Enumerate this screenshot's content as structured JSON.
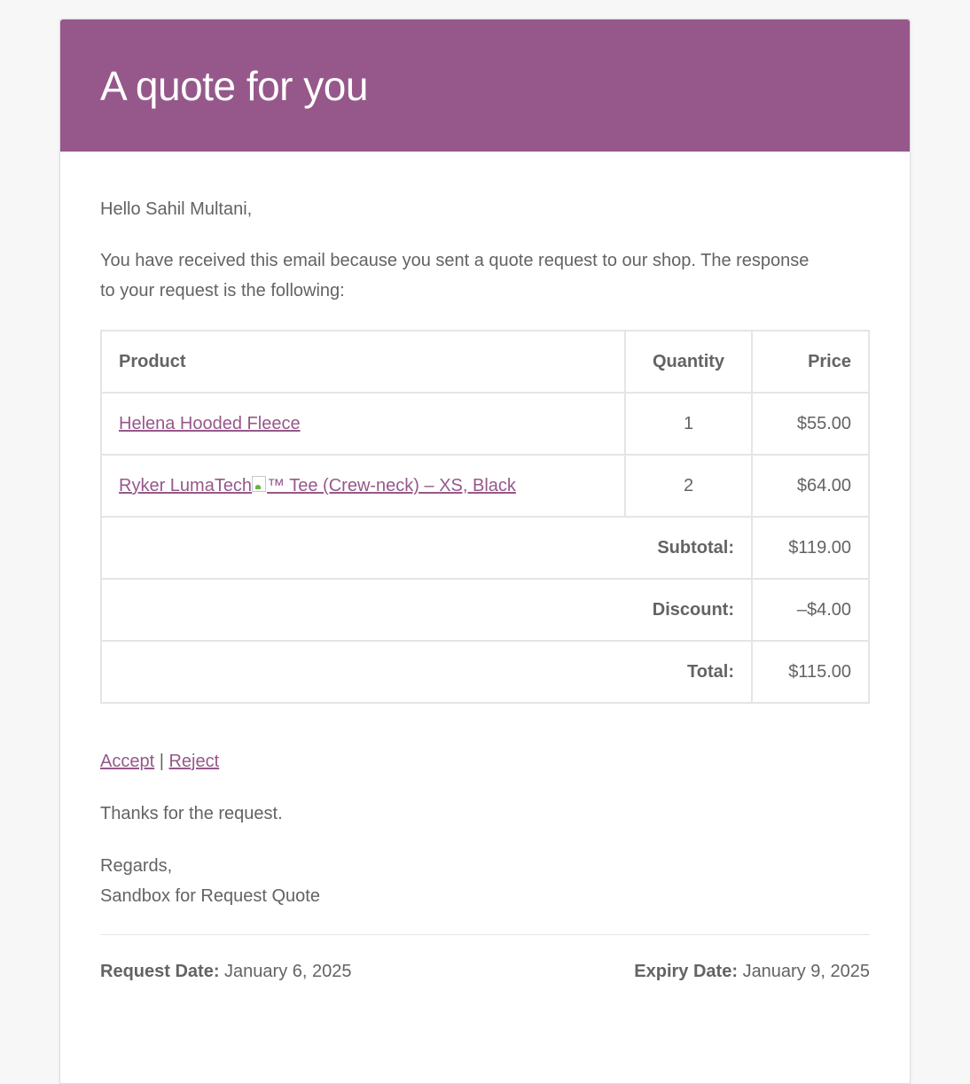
{
  "header": {
    "title": "A quote for you"
  },
  "body": {
    "greeting": "Hello Sahil Multani,",
    "intro": "You have received this email because you sent a quote request to our shop. The response to your request is the following:"
  },
  "table": {
    "headers": {
      "product": "Product",
      "quantity": "Quantity",
      "price": "Price"
    },
    "rows": [
      {
        "product": "Helena Hooded Fleece",
        "quantity": "1",
        "price": "$55.00"
      },
      {
        "product_prefix": "Ryker LumaTech",
        "product_suffix": "™ Tee (Crew-neck) – XS, Black",
        "quantity": "2",
        "price": "$64.00"
      }
    ],
    "totals": [
      {
        "label": "Subtotal:",
        "value": "$119.00"
      },
      {
        "label": "Discount:",
        "value": "–$4.00"
      },
      {
        "label": "Total:",
        "value": "$115.00"
      }
    ]
  },
  "actions": {
    "accept": "Accept",
    "separator": "|",
    "reject": "Reject"
  },
  "footer": {
    "thanks": "Thanks for the request.",
    "regards": "Regards,",
    "shop": "Sandbox for Request Quote",
    "request_date_label": "Request Date:",
    "request_date": "January 6, 2025",
    "expiry_date_label": "Expiry Date:",
    "expiry_date": "January 9, 2025"
  },
  "colors": {
    "brand": "#96588a",
    "text": "#636363",
    "border": "#e5e5e5"
  }
}
